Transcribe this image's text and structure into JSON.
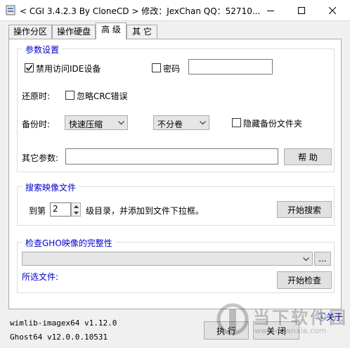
{
  "window": {
    "title": "< CGI 3.4.2.3 By CloneCD > 修改：JexChan  QQ：52710..."
  },
  "tabs": [
    {
      "label": "操作分区",
      "active": false
    },
    {
      "label": "操作硬盘",
      "active": false
    },
    {
      "label": "高 级",
      "active": true
    },
    {
      "label": "其 它",
      "active": false
    }
  ],
  "params": {
    "group_title": "参数设置",
    "disable_ide_label": "禁用访问IDE设备",
    "disable_ide_checked": true,
    "password_label": "密码",
    "password_checked": false,
    "password_value": "",
    "restore_label": "还原时:",
    "ignore_crc_label": "忽略CRC错误",
    "ignore_crc_checked": false,
    "backup_label": "备份时:",
    "compression_value": "快速压缩",
    "split_value": "不分卷",
    "hide_backup_label": "隐藏备份文件夹",
    "hide_backup_checked": false,
    "other_params_label": "其它参数:",
    "other_params_value": "",
    "help_button": "帮 助"
  },
  "search": {
    "group_title": "搜索映像文件",
    "prefix": "到第",
    "level_value": "2",
    "suffix": "级目录，并添加到文件下拉框。",
    "start_button": "开始搜索"
  },
  "verify": {
    "group_title": "检查GHO映像的完整性",
    "file_value": "",
    "browse_button": "...",
    "selected_file_label": "所选文件:",
    "start_button": "开始检查"
  },
  "footer": {
    "version_line1": "wimlib-imagex64 v1.12.0",
    "version_line2": "Ghost64 v12.0.0.10531",
    "about_link": "关于",
    "execute_button": "执 行",
    "close_button": "关 闭"
  },
  "watermark": {
    "text": "当下软件园",
    "url": "www.downxia.com"
  },
  "colors": {
    "accent": "#0000cc",
    "window_bg": "#f0f0f0",
    "panel_bg": "#ffffff"
  }
}
